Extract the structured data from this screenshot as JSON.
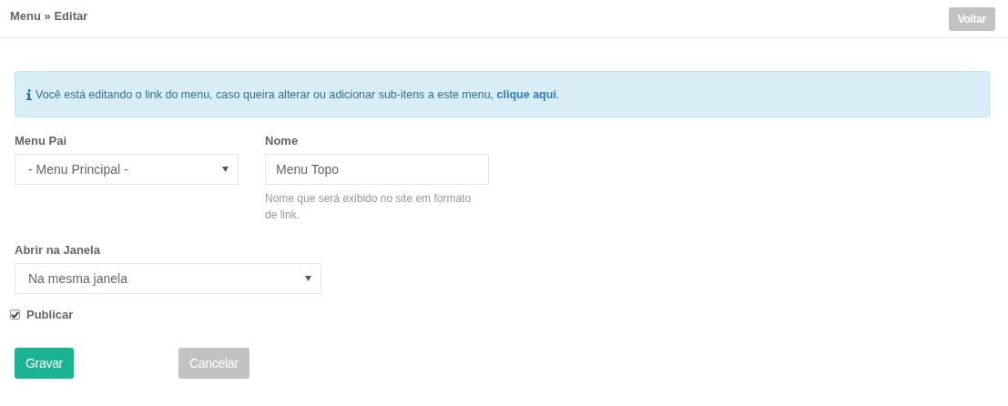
{
  "breadcrumb": {
    "parent": "Menu",
    "separator": "»",
    "current": "Editar"
  },
  "back_button": {
    "label": "Voltar",
    "disabled": true
  },
  "alert": {
    "text": "Você está editando o link do menu, caso queira alterar ou adicionar sub-itens a este menu, ",
    "link": "clique aqui",
    "suffix": "."
  },
  "fields": [
    {
      "kind": "select",
      "label": "Menu Pai",
      "value": "- Menu Principal -"
    },
    {
      "kind": "text",
      "label": "Nome",
      "value": "Menu Topo",
      "help": "Nome que será exibido no site em formato de link."
    },
    {
      "kind": "select",
      "label": "Abrir na Janela",
      "value": "Na mesma janela"
    }
  ],
  "publish": {
    "label": "Publicar",
    "checked": true
  },
  "buttons": [
    {
      "label": "Gravar",
      "kind": "primary",
      "disabled": false
    },
    {
      "label": "Cancelar",
      "kind": "secondary",
      "disabled": true
    }
  ]
}
